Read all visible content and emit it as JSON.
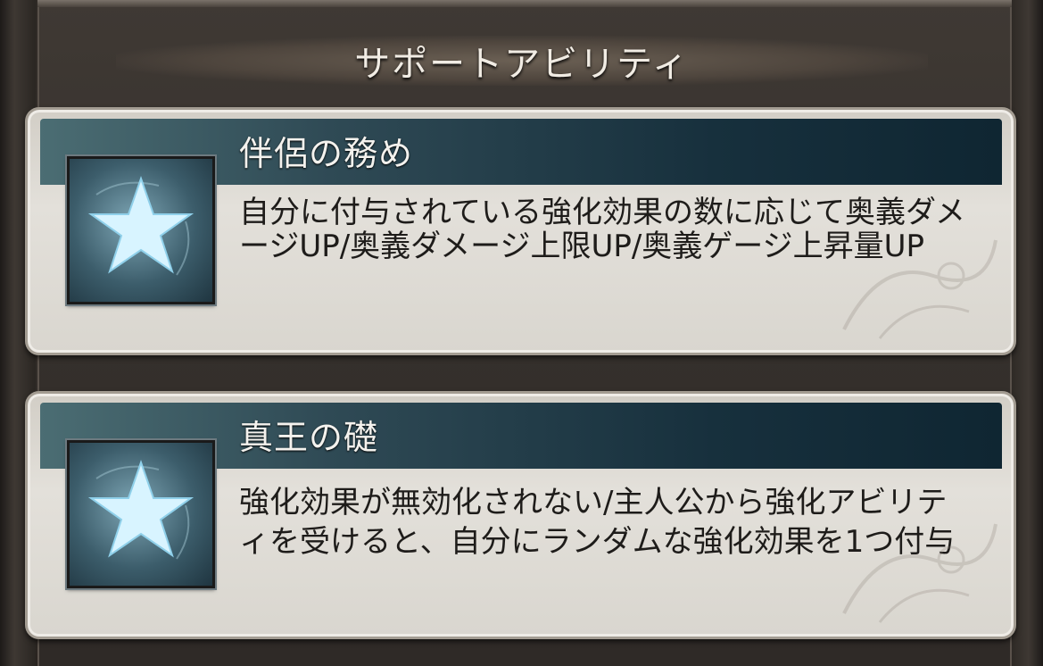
{
  "header": {
    "title": "サポートアビリティ"
  },
  "abilities": [
    {
      "name": "伴侶の務め",
      "description": "自分に付与されている強化効果の数に応じて奥義ダメージUP/奥義ダメージ上限UP/奥義ゲージ上昇量UP",
      "icon": "star-icon"
    },
    {
      "name": "真王の礎",
      "description": "強化効果が無効化されない/主人公から強化アビリティを受けると、自分にランダムな強化効果を1つ付与",
      "icon": "star-icon"
    }
  ],
  "colors": {
    "titlebar": "#17303d",
    "card": "#e3e0da",
    "star": "#d8f4ff"
  }
}
